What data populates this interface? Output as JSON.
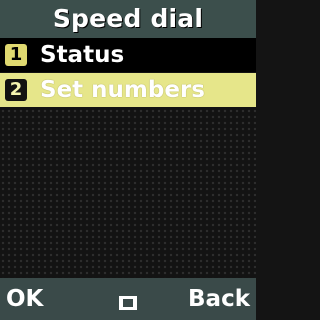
{
  "header": {
    "title": "Speed dial"
  },
  "menu": {
    "items": [
      {
        "number": "1",
        "label": "Status",
        "selected": false
      },
      {
        "number": "2",
        "label": "Set numbers",
        "selected": true
      }
    ]
  },
  "softkeys": {
    "left": "OK",
    "center_icon": "menu-square-icon",
    "right": "Back"
  },
  "colors": {
    "title_bar": "#3c4f4c",
    "highlight": "#e6e68a",
    "badge": "#e0d970",
    "softkey_bar": "#3a4a49"
  }
}
